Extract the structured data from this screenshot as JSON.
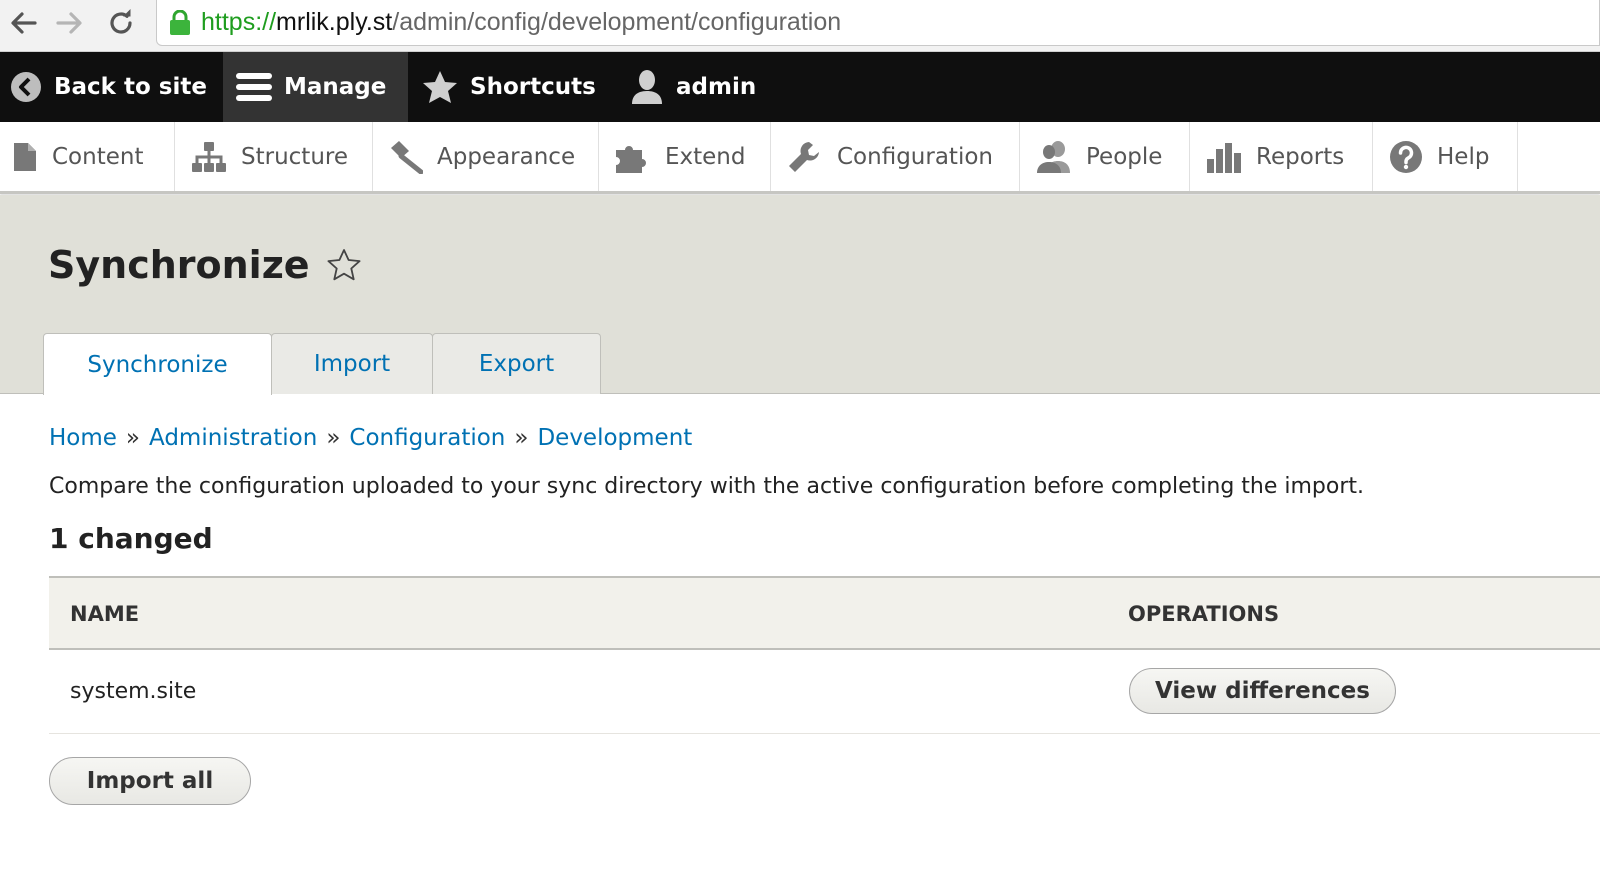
{
  "browser": {
    "url_scheme": "https://",
    "url_host": "mrlik.ply.st",
    "url_path": "/admin/config/development/configuration"
  },
  "toolbar": {
    "back_label": "Back to site",
    "manage_label": "Manage",
    "shortcuts_label": "Shortcuts",
    "user_label": "admin"
  },
  "tray": {
    "items": [
      {
        "label": "Content",
        "icon": "page-icon"
      },
      {
        "label": "Structure",
        "icon": "sitemap-icon"
      },
      {
        "label": "Appearance",
        "icon": "paintbrush-icon"
      },
      {
        "label": "Extend",
        "icon": "puzzle-icon"
      },
      {
        "label": "Configuration",
        "icon": "wrench-icon"
      },
      {
        "label": "People",
        "icon": "people-icon"
      },
      {
        "label": "Reports",
        "icon": "bar-chart-icon"
      },
      {
        "label": "Help",
        "icon": "help-icon"
      }
    ]
  },
  "page": {
    "title": "Synchronize",
    "tabs": [
      {
        "label": "Synchronize",
        "active": true
      },
      {
        "label": "Import",
        "active": false
      },
      {
        "label": "Export",
        "active": false
      }
    ]
  },
  "breadcrumb": {
    "items": [
      "Home",
      "Administration",
      "Configuration",
      "Development"
    ],
    "separator": "»"
  },
  "content": {
    "description": "Compare the configuration uploaded to your sync directory with the active configuration before completing the import.",
    "changed_heading": "1 changed",
    "table": {
      "headers": [
        "NAME",
        "OPERATIONS"
      ],
      "rows": [
        {
          "name": "system.site",
          "operation": "View differences"
        }
      ]
    },
    "import_all_label": "Import all"
  },
  "colors": {
    "link": "#0071b3",
    "toolbar_bg": "#0f0f0f",
    "header_bg": "#e0e0d8",
    "secure_green": "#1f9d1f"
  }
}
